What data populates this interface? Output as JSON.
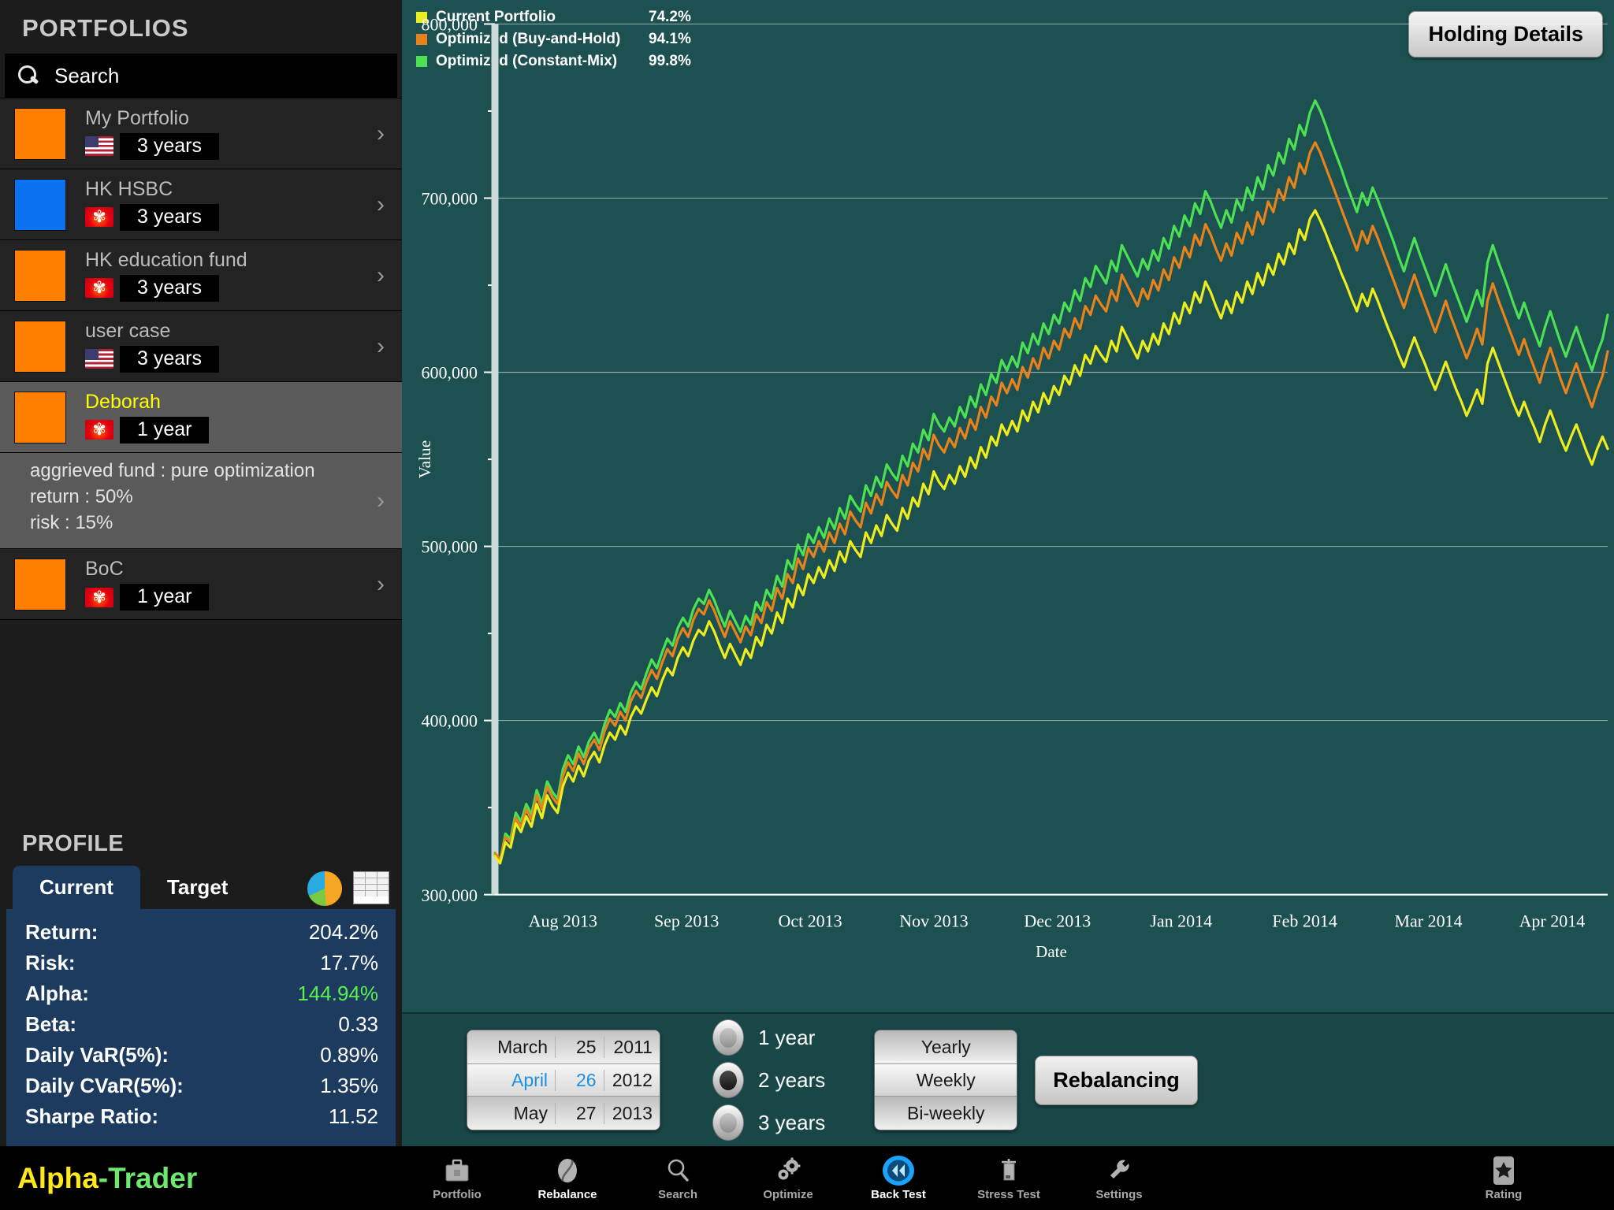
{
  "sidebar": {
    "title": "PORTFOLIOS",
    "search": {
      "placeholder": "Search",
      "value": ""
    },
    "portfolios": [
      {
        "name": "My Portfolio",
        "color": "#FF7F00",
        "flag": "us",
        "period": "3 years",
        "selected": false
      },
      {
        "name": "HK HSBC",
        "color": "#0A72F0",
        "flag": "hk",
        "period": "3 years",
        "selected": false
      },
      {
        "name": "HK education fund",
        "color": "#FF7F00",
        "flag": "hk",
        "period": "3 years",
        "selected": false
      },
      {
        "name": "user case",
        "color": "#FF7F00",
        "flag": "us",
        "period": "3 years",
        "selected": false
      },
      {
        "name": "Deborah",
        "color": "#FF7F00",
        "flag": "hk",
        "period": "1 year",
        "selected": true,
        "detail": [
          "aggrieved fund : pure optimization",
          "return : 50%",
          "risk : 15%"
        ]
      },
      {
        "name": "BoC",
        "color": "#FF7F00",
        "flag": "hk",
        "period": "1 year",
        "selected": false
      }
    ],
    "profile": {
      "title": "PROFILE",
      "tabs": [
        {
          "label": "Current",
          "active": true
        },
        {
          "label": "Target",
          "active": false
        }
      ],
      "icons": [
        "pie-chart-icon",
        "table-icon"
      ],
      "stats": [
        {
          "label": "Return:",
          "value": "204.2%",
          "highlight": false
        },
        {
          "label": "Risk:",
          "value": "17.7%",
          "highlight": false
        },
        {
          "label": "Alpha:",
          "value": "144.94%",
          "highlight": true
        },
        {
          "label": "Beta:",
          "value": "0.33",
          "highlight": false
        },
        {
          "label": "Daily VaR(5%):",
          "value": "0.89%",
          "highlight": false
        },
        {
          "label": "Daily CVaR(5%):",
          "value": "1.35%",
          "highlight": false
        },
        {
          "label": "Sharpe Ratio:",
          "value": "11.52",
          "highlight": false
        }
      ]
    },
    "brand": {
      "first": "Alpha",
      "second": "-Trader"
    }
  },
  "main": {
    "holding_details_label": "Holding Details",
    "legend": [
      {
        "label": "Current Portfolio",
        "value": "74.2%",
        "color": "#ECEC1E"
      },
      {
        "label": "Optimized (Buy-and-Hold)",
        "value": "94.1%",
        "color": "#E8821A"
      },
      {
        "label": "Optimized (Constant-Mix)",
        "value": "99.8%",
        "color": "#4CE053"
      }
    ]
  },
  "chart_data": {
    "type": "line",
    "title": "",
    "xlabel": "Date",
    "ylabel": "Value",
    "grid": true,
    "legend_position": "top-left",
    "ylim": [
      300000,
      800000
    ],
    "yticks": [
      "300,000",
      "400,000",
      "500,000",
      "600,000",
      "700,000",
      "800,000"
    ],
    "ytick_values": [
      300000,
      400000,
      500000,
      600000,
      700000,
      800000
    ],
    "minor_yticks": [
      350000,
      450000,
      550000,
      650000,
      750000
    ],
    "xtick_labels": [
      "Aug 2013",
      "Sep 2013",
      "Oct 2013",
      "Nov 2013",
      "Dec 2013",
      "Jan 2014",
      "Feb 2014",
      "Mar 2014",
      "Apr 2014"
    ],
    "series": [
      {
        "name": "Current Portfolio",
        "color": "#ECEC1E",
        "values": [
          322000,
          318000,
          330000,
          327000,
          341000,
          336000,
          345000,
          339000,
          352000,
          344000,
          357000,
          351000,
          347000,
          362000,
          370000,
          365000,
          374000,
          368000,
          377000,
          382000,
          376000,
          386000,
          393000,
          389000,
          397000,
          392000,
          402000,
          408000,
          404000,
          412000,
          419000,
          414000,
          423000,
          430000,
          426000,
          436000,
          442000,
          437000,
          446000,
          452000,
          449000,
          457000,
          451000,
          443000,
          436000,
          444000,
          438000,
          432000,
          441000,
          436000,
          448000,
          443000,
          455000,
          450000,
          462000,
          456000,
          470000,
          465000,
          478000,
          472000,
          484000,
          479000,
          488000,
          482000,
          492000,
          486000,
          497000,
          491000,
          503000,
          498000,
          494000,
          508000,
          502000,
          512000,
          506000,
          518000,
          513000,
          509000,
          522000,
          516000,
          528000,
          523000,
          536000,
          530000,
          543000,
          537000,
          533000,
          541000,
          536000,
          546000,
          540000,
          551000,
          545000,
          557000,
          551000,
          563000,
          558000,
          570000,
          564000,
          572000,
          566000,
          578000,
          572000,
          583000,
          577000,
          588000,
          582000,
          592000,
          587000,
          598000,
          593000,
          604000,
          598000,
          610000,
          605000,
          615000,
          610000,
          606000,
          618000,
          612000,
          626000,
          620000,
          614000,
          608000,
          618000,
          612000,
          622000,
          616000,
          628000,
          622000,
          634000,
          628000,
          640000,
          634000,
          646000,
          640000,
          652000,
          646000,
          638000,
          631000,
          641000,
          634000,
          646000,
          640000,
          652000,
          645000,
          657000,
          650000,
          662000,
          656000,
          668000,
          662000,
          674000,
          668000,
          682000,
          676000,
          688000,
          693000,
          687000,
          680000,
          672000,
          665000,
          657000,
          650000,
          642000,
          635000,
          645000,
          638000,
          648000,
          641000,
          633000,
          625000,
          618000,
          610000,
          603000,
          612000,
          620000,
          612000,
          605000,
          597000,
          590000,
          598000,
          606000,
          598000,
          590000,
          583000,
          575000,
          582000,
          590000,
          582000,
          605000,
          614000,
          606000,
          598000,
          590000,
          582000,
          575000,
          583000,
          575000,
          568000,
          560000,
          570000,
          578000,
          570000,
          562000,
          555000,
          563000,
          570000,
          562000,
          554000,
          547000,
          556000,
          563000,
          556000
        ]
      },
      {
        "name": "Optimized (Buy-and-Hold)",
        "color": "#E8821A",
        "values": [
          324000,
          320000,
          333000,
          330000,
          344000,
          339000,
          349000,
          343000,
          357000,
          349000,
          362000,
          356000,
          352000,
          368000,
          376000,
          371000,
          381000,
          375000,
          384000,
          389000,
          383000,
          394000,
          401000,
          397000,
          405000,
          400000,
          411000,
          417000,
          413000,
          422000,
          429000,
          424000,
          433000,
          441000,
          437000,
          447000,
          453000,
          448000,
          458000,
          464000,
          461000,
          469000,
          463000,
          455000,
          448000,
          457000,
          451000,
          445000,
          454000,
          449000,
          461000,
          456000,
          468000,
          463000,
          476000,
          470000,
          484000,
          479000,
          493000,
          487000,
          499000,
          494000,
          503000,
          497000,
          508000,
          502000,
          513000,
          507000,
          520000,
          515000,
          511000,
          525000,
          519000,
          530000,
          524000,
          537000,
          532000,
          528000,
          541000,
          535000,
          548000,
          543000,
          556000,
          550000,
          564000,
          558000,
          554000,
          562000,
          557000,
          568000,
          562000,
          573000,
          567000,
          580000,
          574000,
          586000,
          581000,
          594000,
          588000,
          596000,
          590000,
          603000,
          597000,
          608000,
          602000,
          614000,
          608000,
          618000,
          613000,
          625000,
          620000,
          631000,
          625000,
          638000,
          633000,
          644000,
          639000,
          635000,
          647000,
          641000,
          656000,
          650000,
          644000,
          638000,
          648000,
          642000,
          653000,
          647000,
          659000,
          653000,
          666000,
          660000,
          672000,
          666000,
          679000,
          673000,
          685000,
          679000,
          671000,
          664000,
          674000,
          667000,
          680000,
          674000,
          686000,
          679000,
          692000,
          685000,
          698000,
          692000,
          705000,
          699000,
          712000,
          706000,
          720000,
          714000,
          726000,
          732000,
          726000,
          718000,
          710000,
          702000,
          694000,
          686000,
          678000,
          670000,
          681000,
          674000,
          684000,
          677000,
          669000,
          661000,
          653000,
          645000,
          637000,
          647000,
          656000,
          647000,
          639000,
          631000,
          623000,
          632000,
          641000,
          632000,
          624000,
          616000,
          608000,
          616000,
          625000,
          616000,
          641000,
          651000,
          642000,
          634000,
          626000,
          618000,
          610000,
          619000,
          610000,
          602000,
          594000,
          605000,
          614000,
          605000,
          596000,
          588000,
          597000,
          605000,
          596000,
          588000,
          580000,
          590000,
          598000,
          612000
        ]
      },
      {
        "name": "Optimized (Constant-Mix)",
        "color": "#4CE053",
        "values": [
          323000,
          319000,
          335000,
          332000,
          347000,
          342000,
          352000,
          346000,
          360000,
          352000,
          365000,
          359000,
          355000,
          372000,
          380000,
          375000,
          385000,
          379000,
          388000,
          393000,
          387000,
          398000,
          406000,
          402000,
          410000,
          405000,
          416000,
          422000,
          418000,
          427000,
          435000,
          430000,
          439000,
          447000,
          443000,
          453000,
          459000,
          454000,
          464000,
          470000,
          467000,
          475000,
          469000,
          461000,
          454000,
          463000,
          457000,
          451000,
          460000,
          455000,
          468000,
          463000,
          475000,
          470000,
          483000,
          477000,
          492000,
          487000,
          501000,
          495000,
          507000,
          502000,
          511000,
          505000,
          516000,
          510000,
          522000,
          516000,
          529000,
          524000,
          520000,
          535000,
          529000,
          540000,
          534000,
          547000,
          542000,
          538000,
          552000,
          546000,
          559000,
          554000,
          567000,
          561000,
          576000,
          570000,
          566000,
          574000,
          569000,
          580000,
          574000,
          586000,
          580000,
          593000,
          587000,
          599000,
          594000,
          607000,
          601000,
          609000,
          603000,
          617000,
          611000,
          622000,
          616000,
          628000,
          622000,
          633000,
          628000,
          640000,
          635000,
          647000,
          641000,
          654000,
          649000,
          661000,
          656000,
          651000,
          664000,
          658000,
          673000,
          667000,
          661000,
          655000,
          665000,
          659000,
          670000,
          664000,
          677000,
          671000,
          684000,
          678000,
          690000,
          684000,
          697000,
          691000,
          704000,
          698000,
          690000,
          683000,
          693000,
          686000,
          699000,
          693000,
          706000,
          699000,
          712000,
          705000,
          719000,
          713000,
          726000,
          720000,
          734000,
          728000,
          742000,
          736000,
          749000,
          756000,
          750000,
          742000,
          733000,
          725000,
          717000,
          708000,
          700000,
          692000,
          703000,
          696000,
          706000,
          699000,
          691000,
          683000,
          675000,
          666000,
          658000,
          668000,
          677000,
          668000,
          660000,
          652000,
          644000,
          653000,
          662000,
          653000,
          645000,
          637000,
          629000,
          638000,
          647000,
          638000,
          663000,
          673000,
          664000,
          656000,
          648000,
          639000,
          631000,
          640000,
          631000,
          623000,
          615000,
          626000,
          635000,
          626000,
          617000,
          609000,
          618000,
          626000,
          617000,
          609000,
          601000,
          611000,
          619000,
          633000
        ]
      }
    ]
  },
  "controls": {
    "date_picker": {
      "rows": [
        {
          "month": "March",
          "day": "25",
          "year": "2011",
          "selected": false
        },
        {
          "month": "April",
          "day": "26",
          "year": "2012",
          "selected": true
        },
        {
          "month": "May",
          "day": "27",
          "year": "2013",
          "selected": false
        }
      ]
    },
    "horizon_options": [
      {
        "label": "1 year",
        "selected": false
      },
      {
        "label": "2 years",
        "selected": true
      },
      {
        "label": "3 years",
        "selected": false
      }
    ],
    "frequency_options": [
      {
        "label": "Yearly",
        "selected": false
      },
      {
        "label": "Weekly",
        "selected": true
      },
      {
        "label": "Bi-weekly",
        "selected": false
      }
    ],
    "rebalancing_label": "Rebalancing"
  },
  "toolbar": [
    {
      "label": "Portfolio",
      "icon": "briefcase-icon",
      "active": false
    },
    {
      "label": "Rebalance",
      "icon": "bean-icon",
      "active": true
    },
    {
      "label": "Search",
      "icon": "search-icon",
      "active": false
    },
    {
      "label": "Optimize",
      "icon": "gears-icon",
      "active": false
    },
    {
      "label": "Back Test",
      "icon": "rewind-icon",
      "active": true
    },
    {
      "label": "Stress Test",
      "icon": "gauge-icon",
      "active": false
    },
    {
      "label": "Settings",
      "icon": "wrench-icon",
      "active": false
    },
    {
      "label": "Rating",
      "icon": "star-icon",
      "active": false
    }
  ]
}
